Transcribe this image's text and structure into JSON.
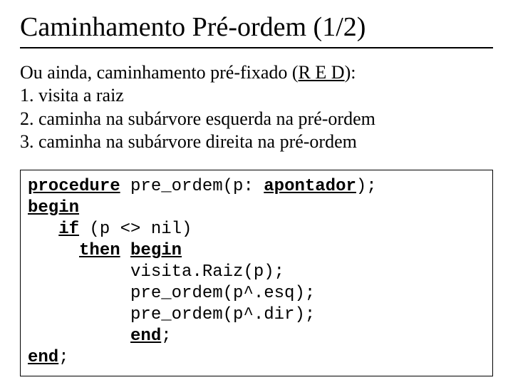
{
  "title": "Caminhamento Pré-ordem (1/2)",
  "intro_prefix": "Ou ainda, caminhamento pré-fixado (",
  "mnemonic": "R E D",
  "intro_suffix": "):",
  "steps": {
    "s1": "1. visita a raiz",
    "s2": "2. caminha na subárvore esquerda na pré-ordem",
    "s3": "3. caminha na subárvore direita na pré-ordem"
  },
  "code": {
    "kw_procedure": "procedure",
    "sig_rest": " pre_ordem(p: ",
    "kw_apontador": "apontador",
    "sig_close": ");",
    "kw_begin1": "begin",
    "indent_if": "   ",
    "kw_if": "if",
    "if_rest": " (p <> nil)",
    "indent_then": "     ",
    "kw_then": "then",
    "space": " ",
    "kw_begin2": "begin",
    "l_visit": "          visita.Raiz(p);",
    "l_esq": "          pre_ordem(p^.esq);",
    "l_dir": "          pre_ordem(p^.dir);",
    "indent_end_inner": "          ",
    "kw_end_inner": "end",
    "semi": ";",
    "kw_end_outer": "end"
  }
}
